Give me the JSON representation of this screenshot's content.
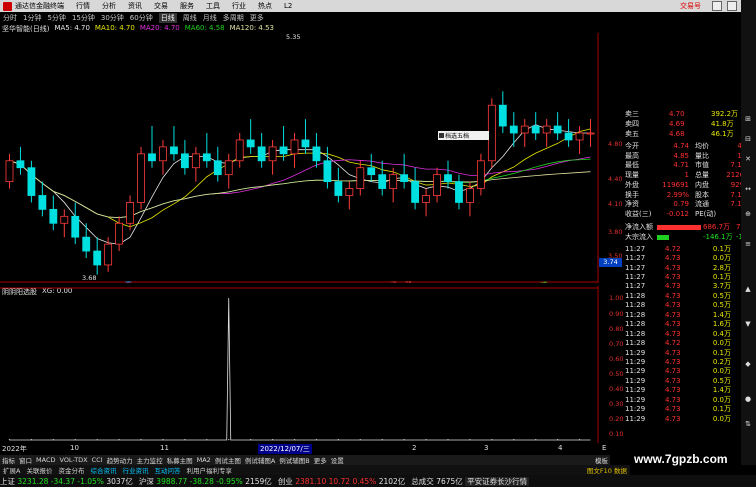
{
  "menubar": {
    "app_title": "通达信金融终端",
    "items": [
      "行情",
      "分析",
      "资讯",
      "交易",
      "服务",
      "工具",
      "行业",
      "热点",
      "L2"
    ],
    "trade_link": "交易号"
  },
  "toolbar": {
    "periods": [
      "分时",
      "1分钟",
      "5分钟",
      "15分钟",
      "30分钟",
      "60分钟",
      "日线",
      "周线",
      "月线",
      "多周期",
      "更多"
    ],
    "active": "日线"
  },
  "legend": {
    "title": "坚华智能(日线)",
    "ma5": "MA5: 4.70",
    "ma10": "MA10: 4.70",
    "ma20": "MA20: 4.70",
    "ma60": "MA60: 4.58",
    "ma120": "MA120: 4.53",
    "colors": {
      "ma5": "#e8e8e8",
      "ma10": "#e8e800",
      "ma20": "#e030e0",
      "ma60": "#20d020",
      "ma120": "#e0e0a0"
    }
  },
  "annotations": {
    "high": "5.35",
    "low": "3.68",
    "price_tag": "3.74",
    "mark1": "赢",
    "mark2": "涨",
    "mark3": "赣",
    "mark4": "减",
    "five_box": "档选五档"
  },
  "indicator": {
    "title": "阴阴阳选股",
    "value": "XG: 0.00"
  },
  "chart_data": {
    "type": "candlestick",
    "yaxis_ticks": [
      "4.80",
      "4.40",
      "4.10",
      "3.80",
      "3.50"
    ],
    "indicator_yticks": [
      "1.00",
      "0.90",
      "0.80",
      "0.70",
      "0.60",
      "0.50",
      "0.40",
      "0.30",
      "0.20",
      "0.10"
    ],
    "candles": [
      [
        4.35,
        4.55,
        4.3,
        4.5
      ],
      [
        4.5,
        4.6,
        4.4,
        4.45
      ],
      [
        4.45,
        4.5,
        4.2,
        4.25
      ],
      [
        4.25,
        4.35,
        4.1,
        4.15
      ],
      [
        4.15,
        4.25,
        4.0,
        4.05
      ],
      [
        4.05,
        4.15,
        3.95,
        4.1
      ],
      [
        4.1,
        4.2,
        3.9,
        3.95
      ],
      [
        3.95,
        4.05,
        3.8,
        3.85
      ],
      [
        3.85,
        3.95,
        3.68,
        3.75
      ],
      [
        3.75,
        3.95,
        3.7,
        3.9
      ],
      [
        3.9,
        4.1,
        3.85,
        4.05
      ],
      [
        4.05,
        4.25,
        4.0,
        4.2
      ],
      [
        4.2,
        4.6,
        4.15,
        4.55
      ],
      [
        4.55,
        4.75,
        4.45,
        4.5
      ],
      [
        4.5,
        4.65,
        4.4,
        4.6
      ],
      [
        4.6,
        4.75,
        4.5,
        4.55
      ],
      [
        4.55,
        4.65,
        4.4,
        4.45
      ],
      [
        4.45,
        4.6,
        4.35,
        4.55
      ],
      [
        4.55,
        4.7,
        4.45,
        4.5
      ],
      [
        4.5,
        4.6,
        4.35,
        4.4
      ],
      [
        4.4,
        4.55,
        4.3,
        4.5
      ],
      [
        4.5,
        4.7,
        4.45,
        4.65
      ],
      [
        4.65,
        4.8,
        4.55,
        4.6
      ],
      [
        4.6,
        4.7,
        4.45,
        4.5
      ],
      [
        4.5,
        4.65,
        4.4,
        4.6
      ],
      [
        4.6,
        4.75,
        4.5,
        4.55
      ],
      [
        4.55,
        4.7,
        4.45,
        4.65
      ],
      [
        4.65,
        4.8,
        4.55,
        4.6
      ],
      [
        4.6,
        4.7,
        4.45,
        4.5
      ],
      [
        4.5,
        4.6,
        4.3,
        4.35
      ],
      [
        4.35,
        4.45,
        4.2,
        4.25
      ],
      [
        4.25,
        4.35,
        4.15,
        4.3
      ],
      [
        4.3,
        4.5,
        4.25,
        4.45
      ],
      [
        4.45,
        4.55,
        4.35,
        4.4
      ],
      [
        4.4,
        4.5,
        4.25,
        4.3
      ],
      [
        4.3,
        4.45,
        4.2,
        4.4
      ],
      [
        4.4,
        4.55,
        4.3,
        4.35
      ],
      [
        4.35,
        4.45,
        4.15,
        4.2
      ],
      [
        4.2,
        4.3,
        4.1,
        4.25
      ],
      [
        4.25,
        4.45,
        4.2,
        4.4
      ],
      [
        4.4,
        4.5,
        4.3,
        4.35
      ],
      [
        4.35,
        4.4,
        4.15,
        4.2
      ],
      [
        4.2,
        4.35,
        4.1,
        4.3
      ],
      [
        4.3,
        4.55,
        4.25,
        4.5
      ],
      [
        4.5,
        4.95,
        4.45,
        4.9
      ],
      [
        4.9,
        5.0,
        4.7,
        4.75
      ],
      [
        4.75,
        4.85,
        4.6,
        4.7
      ],
      [
        4.7,
        4.8,
        4.6,
        4.75
      ],
      [
        4.75,
        4.85,
        4.65,
        4.7
      ],
      [
        4.7,
        4.8,
        4.6,
        4.75
      ],
      [
        4.75,
        4.85,
        4.65,
        4.7
      ],
      [
        4.7,
        4.8,
        4.6,
        4.65
      ],
      [
        4.65,
        4.75,
        4.55,
        4.7
      ],
      [
        4.7,
        4.8,
        4.6,
        4.7
      ]
    ],
    "spike_index": 20
  },
  "quote": {
    "ask_rows": [
      {
        "label": "卖三",
        "price": "4.70",
        "vol": "392.2万"
      },
      {
        "label": "卖四",
        "price": "4.69",
        "vol": "41.8万"
      },
      {
        "label": "卖五",
        "price": "4.68",
        "vol": "46.1万"
      }
    ],
    "stats": [
      {
        "l1": "今开",
        "v1": "4.74",
        "l2": "均价",
        "v2": "4.80"
      },
      {
        "l1": "最高",
        "v1": "4.85",
        "l2": "量比",
        "v2": "1.95"
      },
      {
        "l1": "最低",
        "v1": "4.71",
        "l2": "市值",
        "v2": "7.12亿"
      },
      {
        "l1": "现量",
        "v1": "1",
        "l2": "总量",
        "v2": "212670"
      },
      {
        "l1": "外盘",
        "v1": "119691",
        "l2": "内盘",
        "v2": "92979"
      },
      {
        "l1": "换手",
        "v1": "2.99%",
        "l2": "股本",
        "v2": "7.12亿"
      },
      {
        "l1": "净资",
        "v1": "0.79",
        "l2": "流通",
        "v2": "7.12亿"
      },
      {
        "l1": "收益(三)",
        "v1": "-0.012",
        "l2": "PE(动)",
        "v2": ""
      }
    ],
    "flow": [
      {
        "label": "净流入额",
        "value": "686.7万",
        "pct": "7%"
      },
      {
        "label": "大宗流入",
        "value": "-146.1万",
        "pct": "-1%"
      }
    ],
    "ticks": [
      {
        "t": "11:27",
        "p": "4.72",
        "v": "0.1万",
        "d": "S"
      },
      {
        "t": "11:27",
        "p": "4.73",
        "v": "0.0万",
        "d": "B"
      },
      {
        "t": "11:27",
        "p": "4.73",
        "v": "2.8万",
        "d": "B"
      },
      {
        "t": "11:27",
        "p": "4.73",
        "v": "0.1万",
        "d": "B"
      },
      {
        "t": "11:27",
        "p": "4.73",
        "v": "3.7万",
        "d": "B"
      },
      {
        "t": "11:28",
        "p": "4.73",
        "v": "0.5万",
        "d": "B"
      },
      {
        "t": "11:28",
        "p": "4.73",
        "v": "0.5万",
        "d": "B"
      },
      {
        "t": "11:28",
        "p": "4.73",
        "v": "1.4万",
        "d": "B"
      },
      {
        "t": "11:28",
        "p": "4.73",
        "v": "1.6万",
        "d": "B"
      },
      {
        "t": "11:28",
        "p": "4.73",
        "v": "0.4万",
        "d": "B"
      },
      {
        "t": "11:28",
        "p": "4.72",
        "v": "0.0万",
        "d": "S"
      },
      {
        "t": "11:29",
        "p": "4.73",
        "v": "0.1万",
        "d": "B"
      },
      {
        "t": "11:29",
        "p": "4.73",
        "v": "0.2万",
        "d": "B"
      },
      {
        "t": "11:29",
        "p": "4.73",
        "v": "0.0万",
        "d": "B"
      },
      {
        "t": "11:29",
        "p": "4.73",
        "v": "0.5万",
        "d": "B"
      },
      {
        "t": "11:29",
        "p": "4.73",
        "v": "1.4万",
        "d": "B"
      },
      {
        "t": "11:29",
        "p": "4.73",
        "v": "0.0万",
        "d": "B"
      },
      {
        "t": "11:29",
        "p": "4.73",
        "v": "0.1万",
        "d": "B"
      },
      {
        "t": "11:29",
        "p": "4.73",
        "v": "0.0万",
        "d": "B"
      }
    ]
  },
  "datebar": {
    "labels": [
      "2022年",
      "10",
      "11",
      "2022/12/07/三",
      "2",
      "3",
      "4"
    ],
    "extra": "E"
  },
  "tabs": {
    "items": [
      "指标",
      "窗口",
      "MACD",
      "VOL-TDX",
      "CCI",
      "趋势动力",
      "主力监控",
      "私募主图",
      "MA2",
      "例试主图",
      "例试辅图A",
      "例试辅图B",
      "更多",
      "设置"
    ],
    "active": "2022/12/07/三",
    "mode": "模板"
  },
  "tabs2": {
    "items": [
      "扩展A",
      "关联报价",
      "资金分布",
      "综合资讯",
      "行业资讯",
      "互动问答",
      "利用户福利专享"
    ],
    "highlighted": [
      "综合资讯",
      "行业资讯",
      "互动问答"
    ],
    "right": "图文F10 数据"
  },
  "status": [
    {
      "label": "上证",
      "value": "3231.28",
      "chg": "-34.37",
      "pct": "-1.05%",
      "amt": "3037亿"
    },
    {
      "label": "沪深",
      "value": "3988.77",
      "chg": "-38.28",
      "pct": "-0.95%",
      "amt": "2159亿"
    },
    {
      "label": "创业",
      "value": "2381.10",
      "chg": "10.72",
      "pct": "0.45%",
      "amt": "2102亿"
    }
  ],
  "status_extra": {
    "label": "总成交",
    "value": "7675亿",
    "news": "平安证券长沙行情"
  },
  "watermark": "www.7gpzb.com"
}
